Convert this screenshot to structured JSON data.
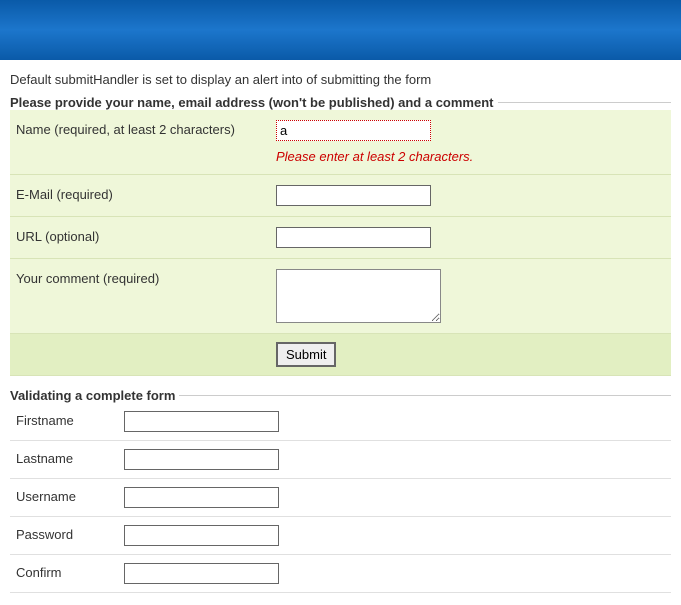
{
  "intro": "Default submitHandler is set to display an alert into of submitting the form",
  "form1": {
    "legend": "Please provide your name, email address (won't be published) and a comment",
    "name": {
      "label": "Name (required, at least 2 characters)",
      "value": "a",
      "error": "Please enter at least 2 characters."
    },
    "email": {
      "label": "E-Mail (required)",
      "value": ""
    },
    "url": {
      "label": "URL (optional)",
      "value": ""
    },
    "comment": {
      "label": "Your comment (required)",
      "value": ""
    },
    "submit": "Submit"
  },
  "form2": {
    "legend": "Validating a complete form",
    "firstname": {
      "label": "Firstname",
      "value": ""
    },
    "lastname": {
      "label": "Lastname",
      "value": ""
    },
    "username": {
      "label": "Username",
      "value": ""
    },
    "password": {
      "label": "Password",
      "value": ""
    },
    "confirm": {
      "label": "Confirm",
      "value": ""
    }
  }
}
